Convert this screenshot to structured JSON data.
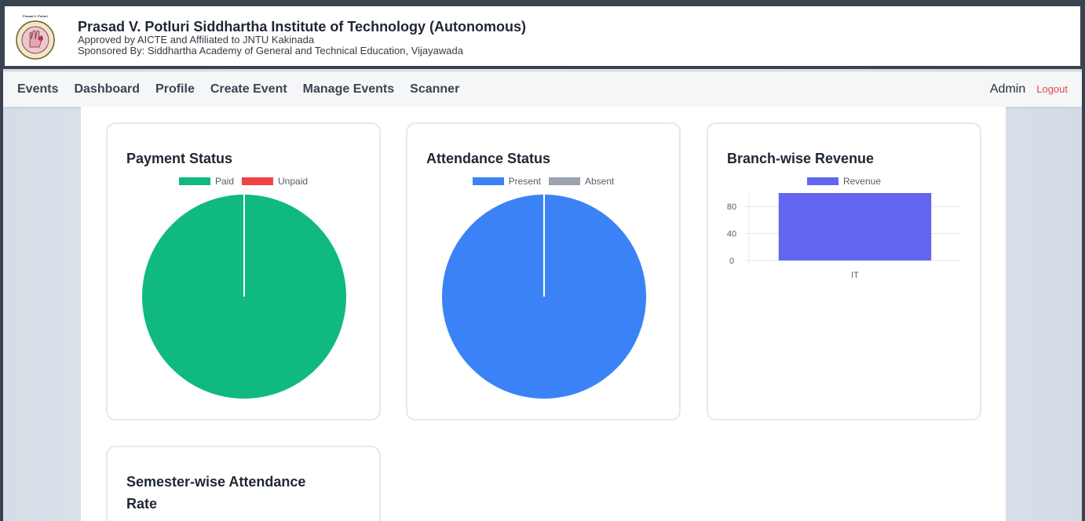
{
  "institute": {
    "title": "Prasad V. Potluri Siddhartha Institute of Technology (Autonomous)",
    "approved": "Approved by AICTE and Affiliated to JNTU Kakinada",
    "sponsored": "Sponsored By: Siddhartha Academy of General and Technical Education, Vijayawada",
    "logo_caption": "Prasad V. Potluri"
  },
  "nav": {
    "links": [
      "Events",
      "Dashboard",
      "Profile",
      "Create Event",
      "Manage Events",
      "Scanner"
    ],
    "user": "Admin",
    "logout": "Logout"
  },
  "cards": {
    "payment": {
      "title": "Payment Status",
      "legend": [
        {
          "label": "Paid",
          "color": "#10b981"
        },
        {
          "label": "Unpaid",
          "color": "#ef4444"
        }
      ]
    },
    "attendance": {
      "title": "Attendance Status",
      "legend": [
        {
          "label": "Present",
          "color": "#3b82f6"
        },
        {
          "label": "Absent",
          "color": "#9ca3af"
        }
      ]
    },
    "branch": {
      "title": "Branch-wise Revenue",
      "legend": [
        {
          "label": "Revenue",
          "color": "#6366f1"
        }
      ]
    },
    "semester": {
      "title": "Semester-wise Attendance Rate"
    }
  },
  "chart_data": [
    {
      "type": "pie",
      "title": "Payment Status",
      "labels": [
        "Paid",
        "Unpaid"
      ],
      "values": [
        100,
        0
      ],
      "colors": [
        "#10b981",
        "#ef4444"
      ],
      "legend": "top"
    },
    {
      "type": "pie",
      "title": "Attendance Status",
      "labels": [
        "Present",
        "Absent"
      ],
      "values": [
        100,
        0
      ],
      "colors": [
        "#3b82f6",
        "#9ca3af"
      ],
      "legend": "top"
    },
    {
      "type": "bar",
      "title": "Branch-wise Revenue",
      "categories": [
        "IT"
      ],
      "series": [
        {
          "name": "Revenue",
          "values": [
            100
          ],
          "color": "#6366f1"
        }
      ],
      "yticks": [
        0,
        40,
        80
      ],
      "ylim": [
        0,
        100
      ],
      "grid": true,
      "legend": "top"
    }
  ]
}
